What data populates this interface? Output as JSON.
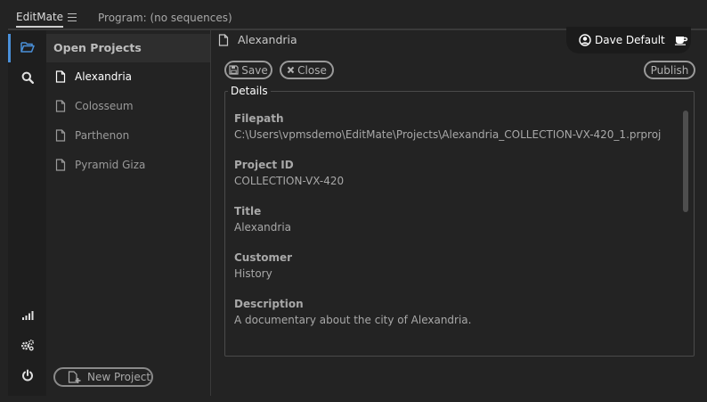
{
  "topbar": {
    "app_tab": "EditMate",
    "program_tab": "Program: (no sequences)"
  },
  "rail": {
    "top_icons": [
      "folder-open-icon",
      "search-icon"
    ],
    "bottom_icons": [
      "signal-icon",
      "settings-icon",
      "power-icon"
    ],
    "accent": "#4a90d9"
  },
  "projects": {
    "header": "Open Projects",
    "items": [
      {
        "label": "Alexandria",
        "active": true
      },
      {
        "label": "Colosseum",
        "active": false
      },
      {
        "label": "Parthenon",
        "active": false
      },
      {
        "label": "Pyramid Giza",
        "active": false
      }
    ],
    "new_project_label": "New Project"
  },
  "main": {
    "title": "Alexandria",
    "user_name": "Dave Default",
    "save_label": "Save",
    "close_label": "Close",
    "publish_label": "Publish",
    "details_legend": "Details",
    "fields": [
      {
        "label": "Filepath",
        "value": "C:\\Users\\vpmsdemo\\EditMate\\Projects\\Alexandria_COLLECTION-VX-420_1.prproj"
      },
      {
        "label": "Project ID",
        "value": "COLLECTION-VX-420"
      },
      {
        "label": "Title",
        "value": "Alexandria"
      },
      {
        "label": "Customer",
        "value": "History"
      },
      {
        "label": "Description",
        "value": "A documentary about the city of Alexandria."
      }
    ]
  }
}
